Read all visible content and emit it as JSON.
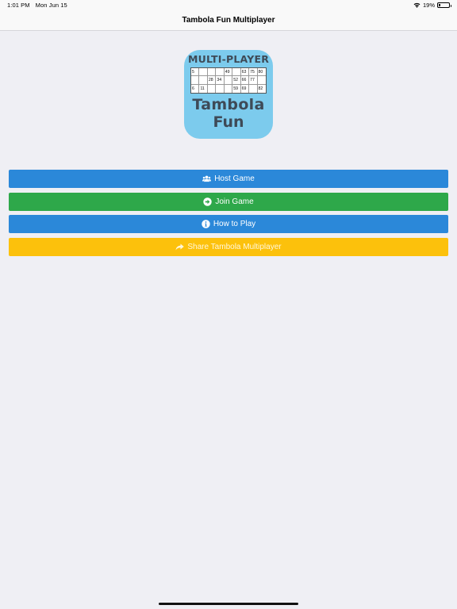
{
  "status_bar": {
    "time": "1:01 PM",
    "date": "Mon Jun 15",
    "battery_text": "19%",
    "battery_level": 0.19
  },
  "nav": {
    "title": "Tambola Fun Multiplayer"
  },
  "logo": {
    "top_text": "MULTI-PLAYER",
    "title": "Tambola",
    "subtitle": "Fun",
    "ticket": [
      [
        "5",
        "",
        "",
        "",
        "49",
        "",
        "63",
        "75",
        "80"
      ],
      [
        "",
        "",
        "28",
        "34",
        "",
        "52",
        "66",
        "77",
        ""
      ],
      [
        "6",
        "11",
        "",
        "",
        "",
        "59",
        "69",
        "",
        "82"
      ]
    ],
    "background_color": "#7ccbed"
  },
  "menu": {
    "host": {
      "label": "Host Game",
      "icon": "users-icon",
      "color": "#2b88d9"
    },
    "join": {
      "label": "Join Game",
      "icon": "arrow-circle-right-icon",
      "color": "#2ea84a"
    },
    "how": {
      "label": "How to Play",
      "icon": "info-circle-icon",
      "color": "#2b88d9"
    },
    "share": {
      "label": "Share Tambola Multiplayer",
      "icon": "share-arrow-icon",
      "color": "#fcc10c"
    }
  }
}
